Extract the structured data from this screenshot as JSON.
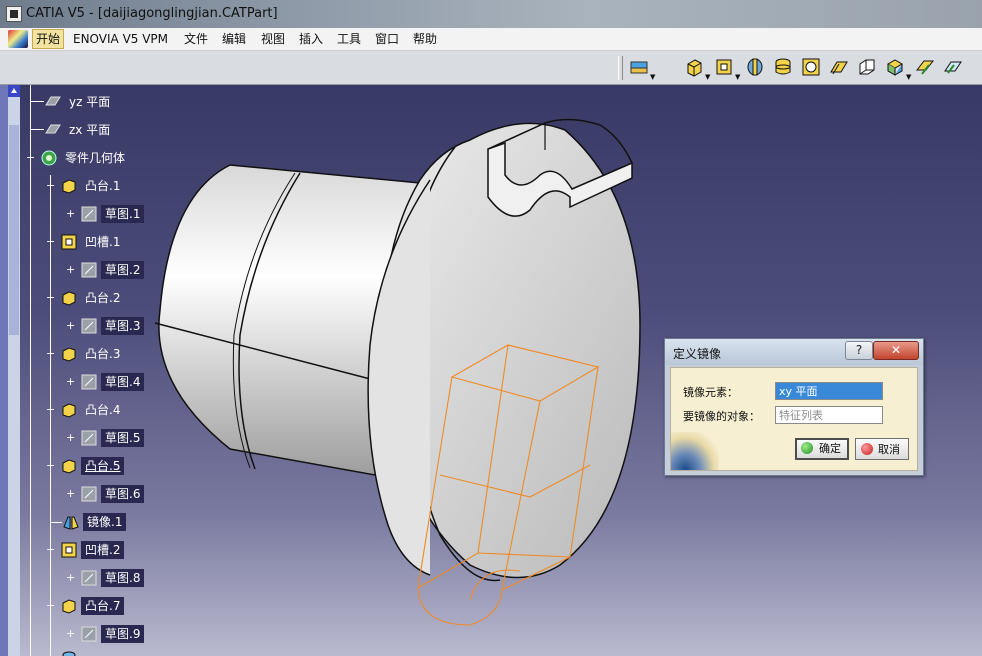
{
  "window": {
    "title": "CATIA V5 - [daijiagonglingjian.CATPart]"
  },
  "menubar": {
    "items": [
      "开始",
      "ENOVIA V5 VPM",
      "文件",
      "编辑",
      "视图",
      "插入",
      "工具",
      "窗口",
      "帮助"
    ]
  },
  "toolbar": {
    "icons": [
      "layers-icon",
      "pad-icon",
      "pocket-icon",
      "shaft-icon",
      "groove-icon",
      "hole-icon",
      "rib-icon",
      "slot-icon",
      "solid-combine-icon",
      "stiffener-icon",
      "loft-icon"
    ]
  },
  "tree": {
    "nodes": [
      {
        "label": "yz 平面",
        "icon": "plane-icon"
      },
      {
        "label": "zx 平面",
        "icon": "plane-icon"
      },
      {
        "label": "零件几何体",
        "icon": "part-body-icon"
      },
      {
        "label": "凸台.1",
        "icon": "pad-icon"
      },
      {
        "label": "草图.1",
        "icon": "sketch-icon"
      },
      {
        "label": "凹槽.1",
        "icon": "pocket-icon"
      },
      {
        "label": "草图.2",
        "icon": "sketch-icon"
      },
      {
        "label": "凸台.2",
        "icon": "pad-icon"
      },
      {
        "label": "草图.3",
        "icon": "sketch-icon"
      },
      {
        "label": "凸台.3",
        "icon": "pad-icon"
      },
      {
        "label": "草图.4",
        "icon": "sketch-icon"
      },
      {
        "label": "凸台.4",
        "icon": "pad-icon"
      },
      {
        "label": "草图.5",
        "icon": "sketch-icon"
      },
      {
        "label": "凸台.5",
        "icon": "pad-icon"
      },
      {
        "label": "草图.6",
        "icon": "sketch-icon"
      },
      {
        "label": "镜像.1",
        "icon": "mirror-icon"
      },
      {
        "label": "凹槽.2",
        "icon": "pocket-icon"
      },
      {
        "label": "草图.8",
        "icon": "sketch-icon"
      },
      {
        "label": "凸台.7",
        "icon": "pad-icon"
      },
      {
        "label": "草图.9",
        "icon": "sketch-icon"
      }
    ]
  },
  "dialog": {
    "title": "定义镜像",
    "help": "?",
    "close": "✕",
    "mirror_element_label": "镜像元素：",
    "mirror_element_value": "xy 平面",
    "object_label": "要镜像的对象：",
    "object_value": "特征列表",
    "ok": "确定",
    "cancel": "取消"
  },
  "colors": {
    "viewport_top": "#393965",
    "viewport_bottom": "#b9b9cf",
    "selection_preview": "#f08a24",
    "field_selected": "#3a88d8"
  }
}
